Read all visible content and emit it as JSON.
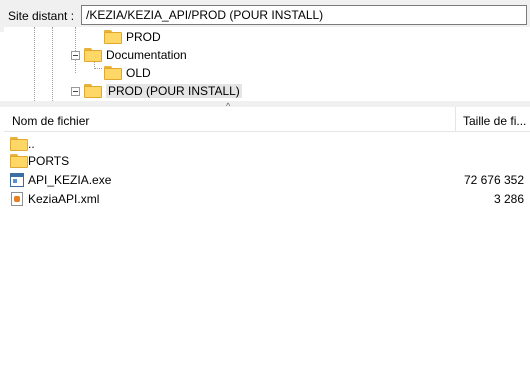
{
  "remote_site": {
    "label": "Site distant :",
    "path": "/KEZIA/KEZIA_API/PROD (POUR INSTALL)"
  },
  "tree": {
    "nodes": [
      {
        "label": "PROD",
        "selected": false,
        "expander": false
      },
      {
        "label": "Documentation",
        "selected": false,
        "expander": true
      },
      {
        "label": "OLD",
        "selected": false,
        "expander": false
      },
      {
        "label": "PROD (POUR INSTALL)",
        "selected": true,
        "expander": true
      }
    ]
  },
  "file_list": {
    "columns": {
      "name": "Nom de fichier",
      "size": "Taille de fi..."
    },
    "sorted_column": "name",
    "rows": [
      {
        "name": "..",
        "size": "",
        "icon": "folder-icon"
      },
      {
        "name": "PORTS",
        "size": "",
        "icon": "folder-icon"
      },
      {
        "name": "API_KEZIA.exe",
        "size": "72 676 352",
        "icon": "exe-file-icon"
      },
      {
        "name": "KeziaAPI.xml",
        "size": "3 286",
        "icon": "xml-file-icon"
      }
    ]
  },
  "colors": {
    "folder": "#ffd766",
    "selection": "#e5e5e5",
    "panel_bg": "#f0f0f0"
  }
}
